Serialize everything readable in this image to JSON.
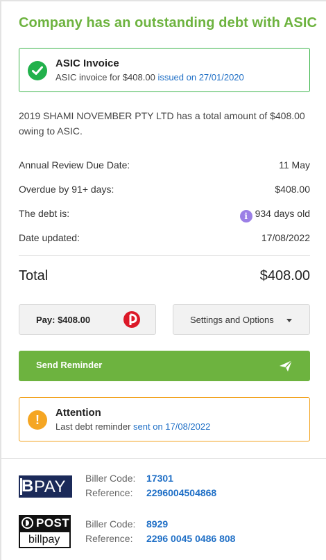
{
  "title": "Company has an outstanding debt with ASIC",
  "invoice": {
    "heading": "ASIC Invoice",
    "text_prefix": "ASIC invoice for $408.00",
    "link": "issued on 27/01/2020"
  },
  "summary": "2019 SHAMI NOVEMBER PTY LTD has a total amount of $408.00 owing to ASIC.",
  "rows": [
    {
      "label": "Annual Review Due Date:",
      "value": "11 May"
    },
    {
      "label": "Overdue by 91+ days:",
      "value": "$408.00"
    },
    {
      "label": "The debt is:",
      "value": "934 days old",
      "icon": "info-icon"
    },
    {
      "label": "Date updated:",
      "value": "17/08/2022"
    }
  ],
  "total": {
    "label": "Total",
    "value": "$408.00"
  },
  "buttons": {
    "pay": "Pay: $408.00",
    "settings": "Settings and Options",
    "reminder": "Send Reminder"
  },
  "attention": {
    "heading": "Attention",
    "text_prefix": "Last debt reminder",
    "link": "sent on 17/08/2022"
  },
  "bpay": {
    "logo_text": "PAY",
    "biller_label": "Biller Code:",
    "biller_code": "17301",
    "reference_label": "Reference:",
    "reference": "2296004504868"
  },
  "post": {
    "logo_top": "POST",
    "logo_bottom": "billpay",
    "biller_label": "Biller Code:",
    "biller_code": "8929",
    "reference_label": "Reference:",
    "reference": "2296 0045 0486 808"
  },
  "colors": {
    "accent_green": "#6db33f",
    "success_green": "#22b14c",
    "warning_orange": "#f5a623",
    "link_blue": "#1f6fc6",
    "info_purple": "#9b7fe6",
    "bpay_navy": "#1b2a59",
    "ap_red": "#dc1928"
  }
}
